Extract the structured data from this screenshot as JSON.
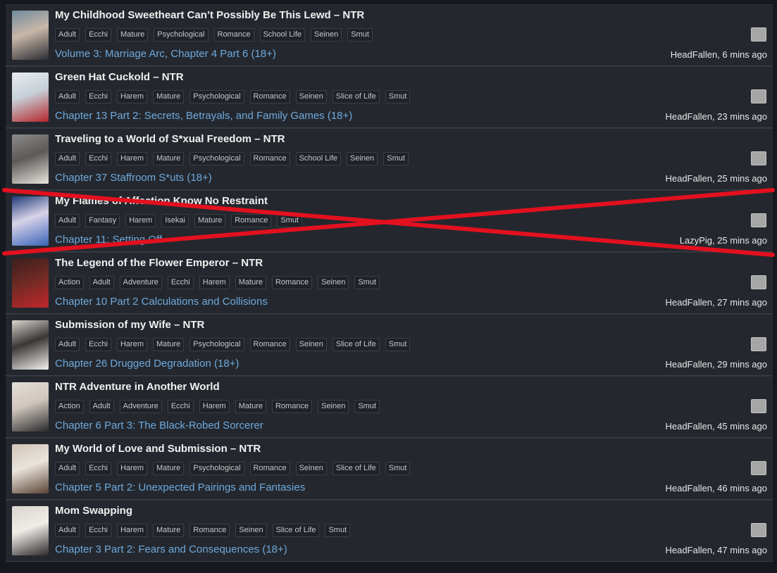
{
  "rows": [
    {
      "title": "My Childhood Sweetheart Can’t Possibly Be This Lewd – NTR",
      "tags": [
        "Adult",
        "Ecchi",
        "Mature",
        "Psychological",
        "Romance",
        "School Life",
        "Seinen",
        "Smut"
      ],
      "chapter": "Volume 3: Marriage Arc, Chapter 4 Part 6 (18+)",
      "meta": "HeadFallen, 6 mins ago",
      "thumb_colors": [
        "#6f8a9c",
        "#2a2d33",
        "#c9b7a8"
      ]
    },
    {
      "title": "Green Hat Cuckold – NTR",
      "tags": [
        "Adult",
        "Ecchi",
        "Harem",
        "Mature",
        "Psychological",
        "Romance",
        "Seinen",
        "Slice of Life",
        "Smut"
      ],
      "chapter": "Chapter 13 Part 2: Secrets, Betrayals, and Family Games (18+)",
      "meta": "HeadFallen, 23 mins ago",
      "thumb_colors": [
        "#e8ecef",
        "#b3262b",
        "#c7d0d8"
      ]
    },
    {
      "title": "Traveling to a World of S*xual Freedom – NTR",
      "tags": [
        "Adult",
        "Ecchi",
        "Harem",
        "Mature",
        "Psychological",
        "Romance",
        "School Life",
        "Seinen",
        "Smut"
      ],
      "chapter": "Chapter 37 Staffroom S*uts (18+)",
      "meta": "HeadFallen, 25 mins ago",
      "thumb_colors": [
        "#8b8b8b",
        "#e9e4df",
        "#5d5a57"
      ]
    },
    {
      "title": "My Flames of Affection Know No Restraint",
      "tags": [
        "Adult",
        "Fantasy",
        "Harem",
        "Isekai",
        "Mature",
        "Romance",
        "Smut"
      ],
      "chapter": "Chapter 11: Setting Off",
      "meta": "LazyPig, 25 mins ago",
      "thumb_colors": [
        "#1e3a78",
        "#3a63b8",
        "#d8d3e8"
      ]
    },
    {
      "title": "The Legend of the Flower Emperor – NTR",
      "tags": [
        "Action",
        "Adult",
        "Adventure",
        "Ecchi",
        "Harem",
        "Mature",
        "Romance",
        "Seinen",
        "Smut"
      ],
      "chapter": "Chapter 10 Part 2 Calculations and Collisions",
      "meta": "HeadFallen, 27 mins ago",
      "thumb_colors": [
        "#3b1e1c",
        "#c0272d",
        "#6e2a24"
      ]
    },
    {
      "title": "Submission of my Wife – NTR",
      "tags": [
        "Adult",
        "Ecchi",
        "Harem",
        "Mature",
        "Psychological",
        "Romance",
        "Seinen",
        "Slice of Life",
        "Smut"
      ],
      "chapter": "Chapter 26 Drugged Degradation (18+)",
      "meta": "HeadFallen, 29 mins ago",
      "thumb_colors": [
        "#d9d5cf",
        "#f4f2ef",
        "#3a3836"
      ]
    },
    {
      "title": "NTR Adventure in Another World",
      "tags": [
        "Action",
        "Adult",
        "Adventure",
        "Ecchi",
        "Harem",
        "Mature",
        "Romance",
        "Seinen",
        "Smut"
      ],
      "chapter": "Chapter 6 Part 3: The Black-Robed Sorcerer",
      "meta": "HeadFallen, 45 mins ago",
      "thumb_colors": [
        "#e4ded8",
        "#2a2a2c",
        "#cfc6bd"
      ]
    },
    {
      "title": "My World of Love and Submission – NTR",
      "tags": [
        "Adult",
        "Ecchi",
        "Harem",
        "Mature",
        "Psychological",
        "Romance",
        "Seinen",
        "Slice of Life",
        "Smut"
      ],
      "chapter": "Chapter 5 Part 2: Unexpected Pairings and Fantasies",
      "meta": "HeadFallen, 46 mins ago",
      "thumb_colors": [
        "#cfc5b8",
        "#5b4434",
        "#eae4dc"
      ]
    },
    {
      "title": "Mom Swapping",
      "tags": [
        "Adult",
        "Ecchi",
        "Harem",
        "Mature",
        "Romance",
        "Seinen",
        "Slice of Life",
        "Smut"
      ],
      "chapter": "Chapter 3 Part 2: Fears and Consequences (18+)",
      "meta": "HeadFallen, 47 mins ago",
      "thumb_colors": [
        "#d8d4d0",
        "#2b2a2a",
        "#f0ece8"
      ]
    }
  ],
  "cross_color": "#e3101f"
}
